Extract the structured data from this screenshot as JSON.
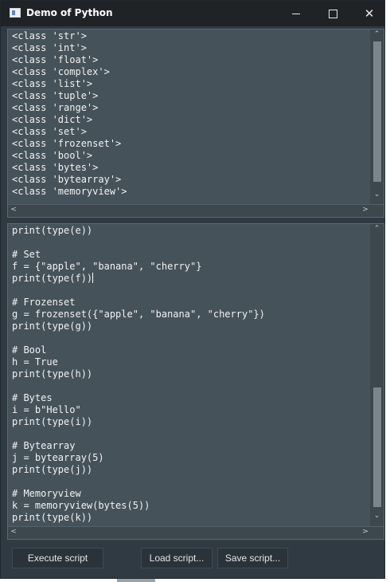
{
  "window": {
    "title": "Demo of Python",
    "minimize_icon": "minimize-icon",
    "maximize_icon": "maximize-icon",
    "close_icon": "close-icon",
    "close_glyph": "✕"
  },
  "output": {
    "lines": [
      "<class 'str'>",
      "<class 'int'>",
      "<class 'float'>",
      "<class 'complex'>",
      "<class 'list'>",
      "<class 'tuple'>",
      "<class 'range'>",
      "<class 'dict'>",
      "<class 'set'>",
      "<class 'frozenset'>",
      "<class 'bool'>",
      "<class 'bytes'>",
      "<class 'bytearray'>",
      "<class 'memoryview'>"
    ]
  },
  "editor": {
    "lines": [
      "print(type(e))",
      "",
      "# Set",
      "f = {\"apple\", \"banana\", \"cherry\"}",
      "print(type(f))",
      "",
      "# Frozenset",
      "g = frozenset({\"apple\", \"banana\", \"cherry\"})",
      "print(type(g))",
      "",
      "# Bool",
      "h = True",
      "print(type(h))",
      "",
      "# Bytes",
      "i = b\"Hello\"",
      "print(type(i))",
      "",
      "# Bytearray",
      "j = bytearray(5)",
      "print(type(j))",
      "",
      "# Memoryview",
      "k = memoryview(bytes(5))",
      "print(type(k))"
    ]
  },
  "scroll": {
    "up": "⌃",
    "down": "⌄",
    "left": "<",
    "right": ">"
  },
  "buttons": {
    "execute": "Execute script",
    "load": "Load script...",
    "save": "Save script..."
  },
  "colors": {
    "background": "#2f3a42",
    "pane": "#46525a",
    "titlebar": "#1f2326",
    "text": "#f2f2f2"
  }
}
